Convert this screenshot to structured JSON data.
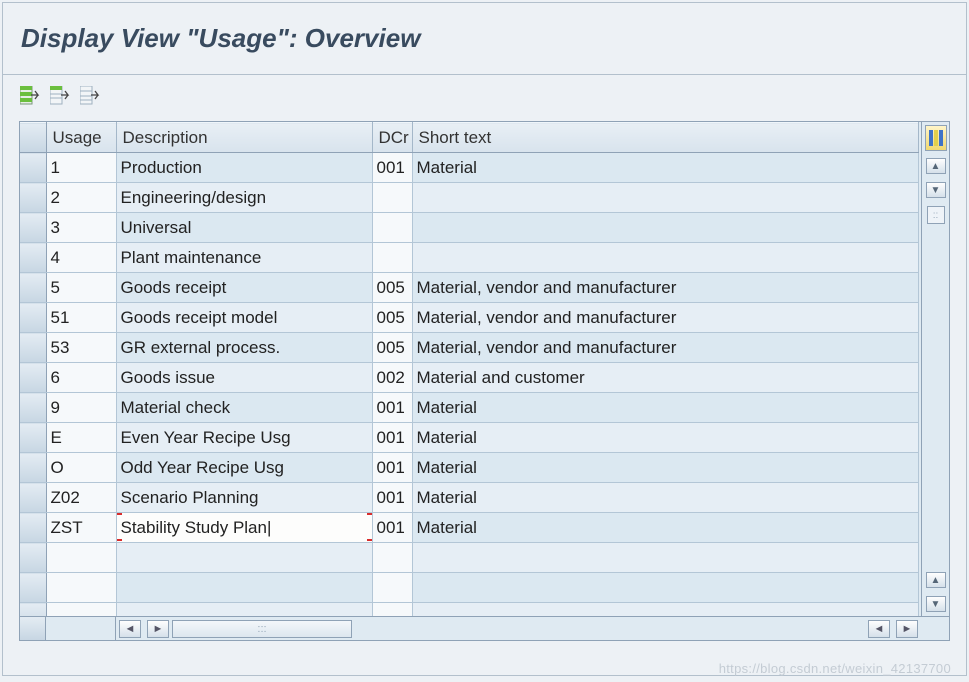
{
  "title": "Display View \"Usage\": Overview",
  "icons": {
    "toolbar1": "row-select-green-icon",
    "toolbar2": "row-select-icon",
    "toolbar3": "row-settings-icon"
  },
  "headers": {
    "usage": "Usage",
    "description": "Description",
    "dcr": "DCr",
    "shorttext": "Short text"
  },
  "rows": [
    {
      "usage": "1",
      "desc": "Production",
      "dcr": "001",
      "short": "Material"
    },
    {
      "usage": "2",
      "desc": "Engineering/design",
      "dcr": "",
      "short": ""
    },
    {
      "usage": "3",
      "desc": "Universal",
      "dcr": "",
      "short": ""
    },
    {
      "usage": "4",
      "desc": "Plant maintenance",
      "dcr": "",
      "short": ""
    },
    {
      "usage": "5",
      "desc": "Goods receipt",
      "dcr": "005",
      "short": "Material, vendor and manufacturer"
    },
    {
      "usage": "51",
      "desc": "Goods receipt model",
      "dcr": "005",
      "short": "Material, vendor and manufacturer"
    },
    {
      "usage": "53",
      "desc": "GR external process.",
      "dcr": "005",
      "short": "Material, vendor and manufacturer"
    },
    {
      "usage": "6",
      "desc": "Goods issue",
      "dcr": "002",
      "short": "Material and customer"
    },
    {
      "usage": "9",
      "desc": "Material check",
      "dcr": "001",
      "short": "Material"
    },
    {
      "usage": "E",
      "desc": "Even Year Recipe Usg",
      "dcr": "001",
      "short": "Material"
    },
    {
      "usage": "O",
      "desc": "Odd Year Recipe Usg",
      "dcr": "001",
      "short": "Material"
    },
    {
      "usage": "Z02",
      "desc": "Scenario Planning",
      "dcr": "001",
      "short": "Material"
    },
    {
      "usage": "ZST",
      "desc": "Stability Study Plan|",
      "dcr": "001",
      "short": "Material",
      "editing": true
    },
    {
      "usage": "",
      "desc": "",
      "dcr": "",
      "short": ""
    },
    {
      "usage": "",
      "desc": "",
      "dcr": "",
      "short": ""
    },
    {
      "usage": "",
      "desc": "",
      "dcr": "",
      "short": ""
    }
  ],
  "watermark": "https://blog.csdn.net/weixin_42137700"
}
